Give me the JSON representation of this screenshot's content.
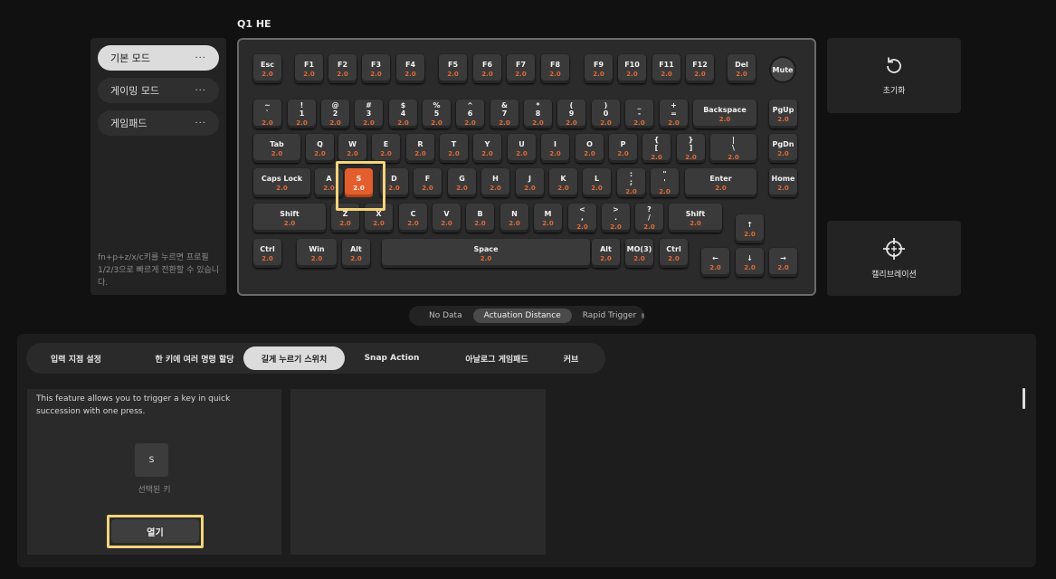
{
  "device": {
    "title": "Q1 HE"
  },
  "profiles": {
    "items": [
      {
        "label": "기본 모드",
        "more": "···",
        "active": true
      },
      {
        "label": "게이밍 모드",
        "more": "···",
        "active": false
      },
      {
        "label": "게임패드",
        "more": "···",
        "active": false
      }
    ],
    "hint": "fn+p+z/x/c키를 누르면 프로필 1/2/3으로 빠르게 전환할 수 있습니다."
  },
  "keyboard": {
    "selected_key": "S",
    "rows": [
      [
        [
          "Esc",
          "2.0"
        ],
        [
          "F1",
          "2.0"
        ],
        [
          "F2",
          "2.0"
        ],
        [
          "F3",
          "2.0"
        ],
        [
          "F4",
          "2.0"
        ],
        [
          "F5",
          "2.0"
        ],
        [
          "F6",
          "2.0"
        ],
        [
          "F7",
          "2.0"
        ],
        [
          "F8",
          "2.0"
        ],
        [
          "F9",
          "2.0"
        ],
        [
          "F10",
          "2.0"
        ],
        [
          "F11",
          "2.0"
        ],
        [
          "F12",
          "2.0"
        ],
        [
          "Del",
          "2.0"
        ],
        [
          "Mute",
          ""
        ]
      ],
      [
        [
          "~\n`",
          "2.0"
        ],
        [
          "!\n1",
          "2.0"
        ],
        [
          "@\n2",
          "2.0"
        ],
        [
          "#\n3",
          "2.0"
        ],
        [
          "$\n4",
          "2.0"
        ],
        [
          "%\n5",
          "2.0"
        ],
        [
          "^\n6",
          "2.0"
        ],
        [
          "&\n7",
          "2.0"
        ],
        [
          "*\n8",
          "2.0"
        ],
        [
          "(\n9",
          "2.0"
        ],
        [
          ")\n0",
          "2.0"
        ],
        [
          "_\n-",
          "2.0"
        ],
        [
          "+\n=",
          "2.0"
        ],
        [
          "Backspace",
          "2.0"
        ],
        [
          "PgUp",
          "2.0"
        ]
      ],
      [
        [
          "Tab",
          "2.0"
        ],
        [
          "Q",
          "2.0"
        ],
        [
          "W",
          "2.0"
        ],
        [
          "E",
          "2.0"
        ],
        [
          "R",
          "2.0"
        ],
        [
          "T",
          "2.0"
        ],
        [
          "Y",
          "2.0"
        ],
        [
          "U",
          "2.0"
        ],
        [
          "I",
          "2.0"
        ],
        [
          "O",
          "2.0"
        ],
        [
          "P",
          "2.0"
        ],
        [
          "{\n[",
          "2.0"
        ],
        [
          "}\n]",
          "2.0"
        ],
        [
          "|\n\\",
          "2.0"
        ],
        [
          "PgDn",
          "2.0"
        ]
      ],
      [
        [
          "Caps Lock",
          "2.0"
        ],
        [
          "A",
          "2.0"
        ],
        [
          "S",
          "2.0"
        ],
        [
          "D",
          "2.0"
        ],
        [
          "F",
          "2.0"
        ],
        [
          "G",
          "2.0"
        ],
        [
          "H",
          "2.0"
        ],
        [
          "J",
          "2.0"
        ],
        [
          "K",
          "2.0"
        ],
        [
          "L",
          "2.0"
        ],
        [
          ":\n;",
          "2.0"
        ],
        [
          "\"\n'",
          "2.0"
        ],
        [
          "Enter",
          "2.0"
        ],
        [
          "Home",
          "2.0"
        ]
      ],
      [
        [
          "Shift",
          "2.0"
        ],
        [
          "Z",
          "2.0"
        ],
        [
          "X",
          "2.0"
        ],
        [
          "C",
          "2.0"
        ],
        [
          "V",
          "2.0"
        ],
        [
          "B",
          "2.0"
        ],
        [
          "N",
          "2.0"
        ],
        [
          "M",
          "2.0"
        ],
        [
          "<\n,",
          "2.0"
        ],
        [
          ">\n.",
          "2.0"
        ],
        [
          "?\n/",
          "2.0"
        ],
        [
          "Shift",
          "2.0"
        ],
        [
          "↑",
          "2.0"
        ]
      ],
      [
        [
          "Ctrl",
          "2.0"
        ],
        [
          "Win",
          "2.0"
        ],
        [
          "Alt",
          "2.0"
        ],
        [
          "Space",
          "2.0"
        ],
        [
          "Alt",
          "2.0"
        ],
        [
          "MO(3)",
          "2.0"
        ],
        [
          "Ctrl",
          "2.0"
        ],
        [
          "←",
          "2.0"
        ],
        [
          "↓",
          "2.0"
        ],
        [
          "→",
          "2.0"
        ]
      ]
    ]
  },
  "side_buttons": {
    "reset": "초기화",
    "calibrate": "캘리브레이션"
  },
  "mode_toggle": {
    "items": [
      "No Data",
      "Actuation Distance",
      "Rapid Trigger"
    ],
    "active": "Actuation Distance"
  },
  "tabs": [
    {
      "label": "입력 지점 설정",
      "active": false
    },
    {
      "label": "한 키에 여러 명령 할당",
      "active": false
    },
    {
      "label": "길게 누르기 스위치",
      "active": true
    },
    {
      "label": "Snap Action",
      "active": false
    },
    {
      "label": "아날로그 게임패드",
      "active": false
    },
    {
      "label": "커브",
      "active": false
    }
  ],
  "feature": {
    "description": "This feature allows you to trigger a key in quick succession with one press.",
    "selected_key": "S",
    "selected_caption": "선택된 키",
    "open_button": "열기"
  },
  "colors": {
    "accent": "#e35e2c",
    "highlight": "#f4d47a",
    "value_text": "#e06a3a"
  }
}
